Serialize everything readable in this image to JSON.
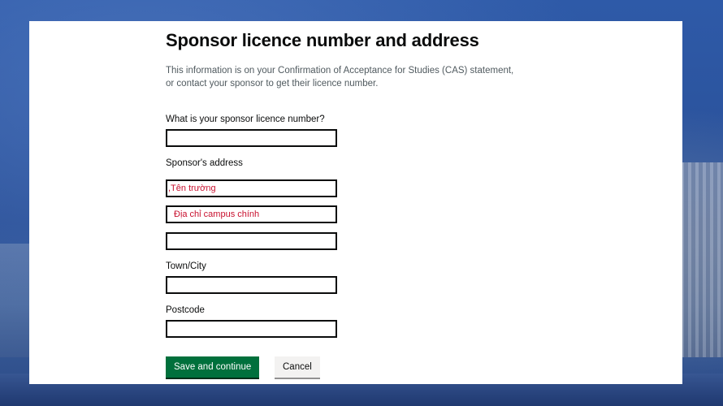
{
  "page": {
    "title": "Sponsor licence number and address",
    "hint_line1": "This information is on your Confirmation of Acceptance for Studies (CAS) statement,",
    "hint_line2": "or contact your sponsor to get their licence number."
  },
  "form": {
    "licence_label": "What is your sponsor licence number?",
    "licence_value": "",
    "address_label": "Sponsor's address",
    "address_line1_value": ",Tên trường",
    "address_line2_value": "Địa chỉ campus chính",
    "address_line3_value": "",
    "town_label": "Town/City",
    "town_value": "",
    "postcode_label": "Postcode",
    "postcode_value": ""
  },
  "actions": {
    "save_label": "Save and continue",
    "cancel_label": "Cancel"
  },
  "colors": {
    "primary_button": "#00703c",
    "annotation_text": "#c8102e",
    "background": "#2e5aa8"
  }
}
